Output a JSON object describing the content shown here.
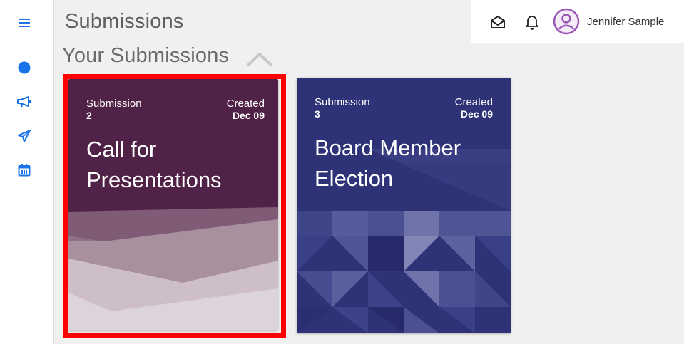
{
  "page": {
    "title": "Submissions"
  },
  "section": {
    "title": "Your Submissions"
  },
  "user": {
    "name": "Jennifer Sample"
  },
  "sidebar": {
    "items": [
      {
        "icon": "menu-icon"
      },
      {
        "icon": "dot-icon"
      },
      {
        "icon": "megaphone-icon"
      },
      {
        "icon": "paper-plane-icon"
      },
      {
        "icon": "calendar-icon"
      }
    ]
  },
  "cards": [
    {
      "submission_label": "Submission",
      "number": "2",
      "created_label": "Created",
      "date": "Dec 09",
      "title": "Call for Presentations",
      "color": "#512247"
    },
    {
      "submission_label": "Submission",
      "number": "3",
      "created_label": "Created",
      "date": "Dec 09",
      "title": "Board Member Election",
      "color": "#2e3378"
    }
  ],
  "colors": {
    "accent": "#1a73e8",
    "highlight": "#ff0000"
  }
}
